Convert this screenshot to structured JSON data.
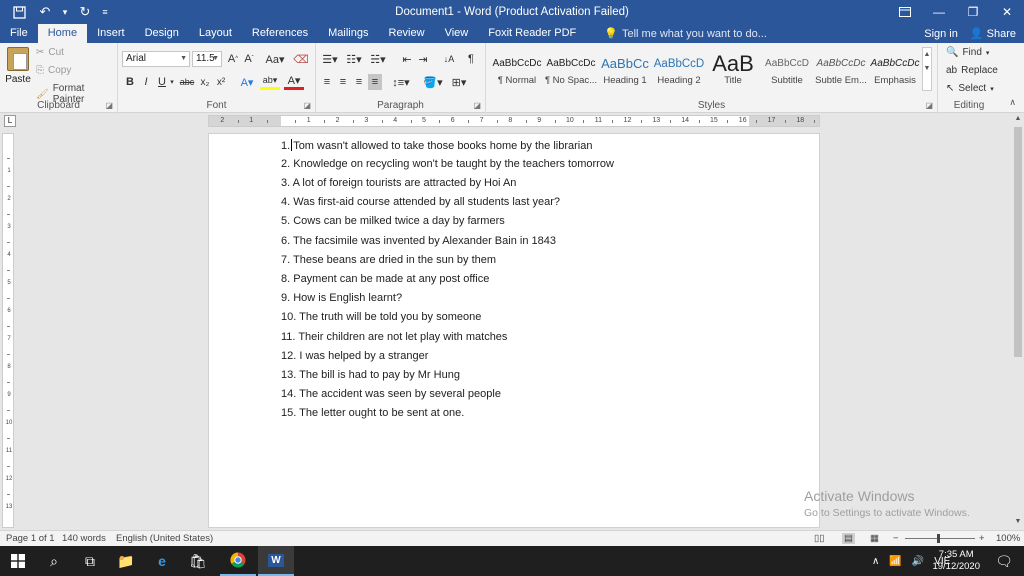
{
  "window": {
    "title": "Document1 - Word (Product Activation Failed)"
  },
  "tabs": [
    "File",
    "Home",
    "Insert",
    "Design",
    "Layout",
    "References",
    "Mailings",
    "Review",
    "View",
    "Foxit Reader PDF"
  ],
  "tell_me": "Tell me what you want to do...",
  "sign_in": "Sign in",
  "share": "Share",
  "clipboard": {
    "paste": "Paste",
    "cut": "Cut",
    "copy": "Copy",
    "format_painter": "Format Painter",
    "label": "Clipboard"
  },
  "font": {
    "name": "Arial",
    "size": "11.5",
    "label": "Font"
  },
  "paragraph": {
    "label": "Paragraph"
  },
  "styles": {
    "label": "Styles",
    "items": [
      {
        "sample": "AaBbCcDc",
        "name": "¶ Normal"
      },
      {
        "sample": "AaBbCcDc",
        "name": "¶ No Spac..."
      },
      {
        "sample": "AaBbCc",
        "name": "Heading 1"
      },
      {
        "sample": "AaBbCcD",
        "name": "Heading 2"
      },
      {
        "sample": "AaB",
        "name": "Title"
      },
      {
        "sample": "AaBbCcD",
        "name": "Subtitle"
      },
      {
        "sample": "AaBbCcDc",
        "name": "Subtle Em..."
      },
      {
        "sample": "AaBbCcDc",
        "name": "Emphasis"
      }
    ]
  },
  "editing": {
    "find": "Find",
    "replace": "Replace",
    "select": "Select",
    "label": "Editing"
  },
  "document": {
    "lines": [
      "1.Tom wasn't allowed to take those books home by the librarian",
      "2. Knowledge on recycling won't be taught by the teachers tomorrow",
      "3. A lot of foreign tourists are attracted by Hoi An",
      "4. Was first-aid course attended by all students last year?",
      "5. Cows can be milked twice a day by farmers",
      "6. The facsimile was invented by Alexander Bain in 1843",
      "7. These beans are dried in the sun by them",
      "8. Payment can be made at any post office",
      "9. How is English learnt?",
      "10. The truth will be told you by someone",
      "11. Their children are not let play with matches",
      "12. I was helped by a stranger",
      "13. The bill is had to pay by Mr Hung",
      "14. The accident was seen by several people",
      "15. The letter ought to be sent at one."
    ]
  },
  "watermark": {
    "line1": "Activate Windows",
    "line2": "Go to Settings to activate Windows."
  },
  "status": {
    "page": "Page 1 of 1",
    "words": "140 words",
    "language": "English (United States)",
    "zoom": "100%"
  },
  "taskbar": {
    "lang": "VIE",
    "time": "7:35 AM",
    "date": "19/12/2020"
  }
}
